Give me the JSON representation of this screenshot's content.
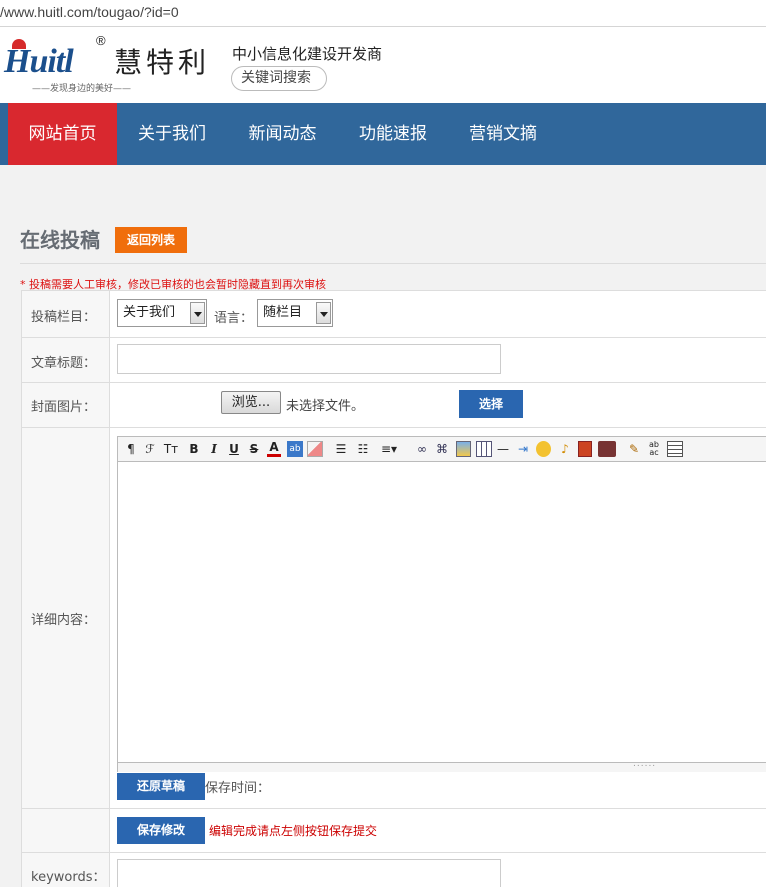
{
  "browser": {
    "url": "/www.huitl.com/tougao/?id=0"
  },
  "header": {
    "logo_text": "Huitl",
    "logo_registered": "®",
    "logo_cn": "慧特利",
    "logo_tagline": "——发现身边的美好——",
    "slogan": "中小信息化建设开发商",
    "keyword_search_label": "关键词搜索"
  },
  "nav": {
    "items": [
      {
        "label": "网站首页",
        "active": true
      },
      {
        "label": "关于我们"
      },
      {
        "label": "新闻动态"
      },
      {
        "label": "功能速报"
      },
      {
        "label": "营销文摘"
      }
    ],
    "color": "#30679b",
    "active_color": "#d9282f"
  },
  "page": {
    "title": "在线投稿",
    "back_button": "返回列表",
    "note": "* 投稿需要人工审核，修改已审核的也会暂时隐藏直到再次审核"
  },
  "form": {
    "category_label": "投稿栏目：",
    "category_value": "关于我们",
    "language_label": "语言：",
    "language_value": "随栏目",
    "title_label": "文章标题：",
    "title_value": "",
    "cover_label": "封面图片：",
    "browse_button": "浏览...",
    "no_file_text": "未选择文件。",
    "choose_button": "选择",
    "content_label": "详细内容：",
    "editor_footer": "......",
    "restore_button": "还原草稿",
    "save_time_label": "保存时间：",
    "save_button": "保存修改",
    "save_hint": "编辑完成请点左侧按钮保存提交",
    "keywords_label": "keywords："
  },
  "toolbar": {
    "tools": [
      "paragraph-icon",
      "font-family-icon",
      "font-size-icon",
      "bold-icon",
      "italic-icon",
      "underline-icon",
      "strikethrough-icon",
      "font-color-icon",
      "highlight-icon",
      "eraser-icon",
      "align-icon",
      "unordered-list-icon",
      "ordered-list-icon",
      "link-icon",
      "unlink-icon",
      "image-icon",
      "table-icon",
      "horizontal-rule-icon",
      "indent-icon",
      "emoticon-icon",
      "music-icon",
      "flash-icon",
      "video-icon",
      "format-brush-icon",
      "spellcheck-icon",
      "page-break-icon"
    ]
  },
  "colors": {
    "accent_orange": "#f06e0c",
    "button_blue": "#2a66b0",
    "note_red": "#d11"
  }
}
